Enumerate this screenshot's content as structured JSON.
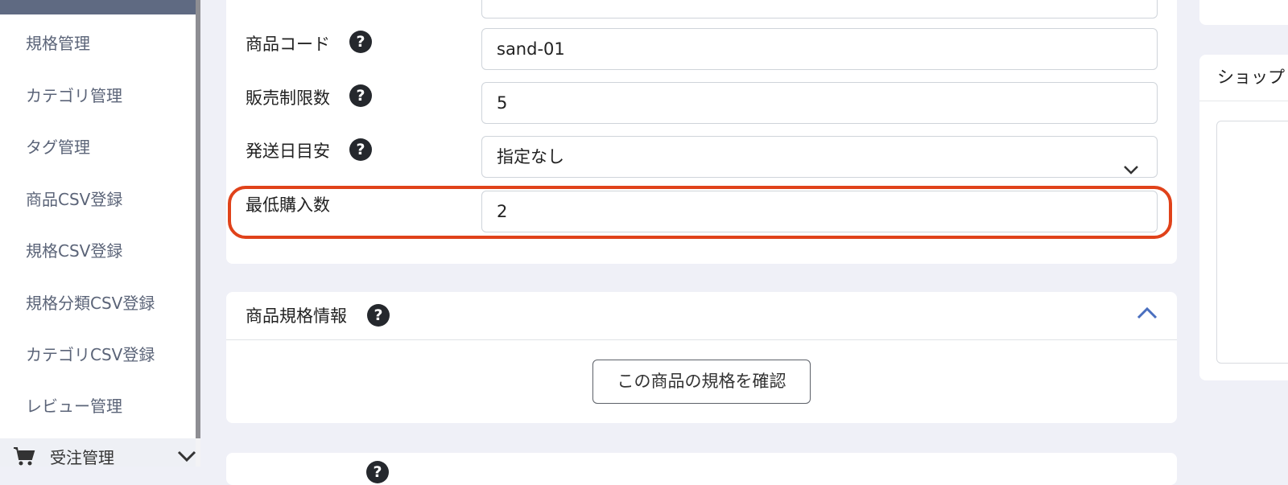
{
  "sidebar": {
    "items": [
      {
        "label": "規格管理"
      },
      {
        "label": "カテゴリ管理"
      },
      {
        "label": "タグ管理"
      },
      {
        "label": "商品CSV登録"
      },
      {
        "label": "規格CSV登録"
      },
      {
        "label": "規格分類CSV登録"
      },
      {
        "label": "カテゴリCSV登録"
      },
      {
        "label": "レビュー管理"
      }
    ],
    "group": {
      "label": "受注管理",
      "icon": "cart-icon"
    }
  },
  "form": {
    "product_code": {
      "label": "商品コード",
      "value": "sand-01"
    },
    "sale_limit": {
      "label": "販売制限数",
      "value": "5"
    },
    "delivery": {
      "label": "発送日目安",
      "value": "指定なし"
    },
    "min_purchase": {
      "label": "最低購入数",
      "value": "2"
    }
  },
  "spec_section": {
    "title": "商品規格情報",
    "button_label": "この商品の規格を確認"
  },
  "right_panel": {
    "title": "ショップ"
  },
  "colors": {
    "highlight": "#e0421a",
    "accent": "#4a6fbf"
  }
}
